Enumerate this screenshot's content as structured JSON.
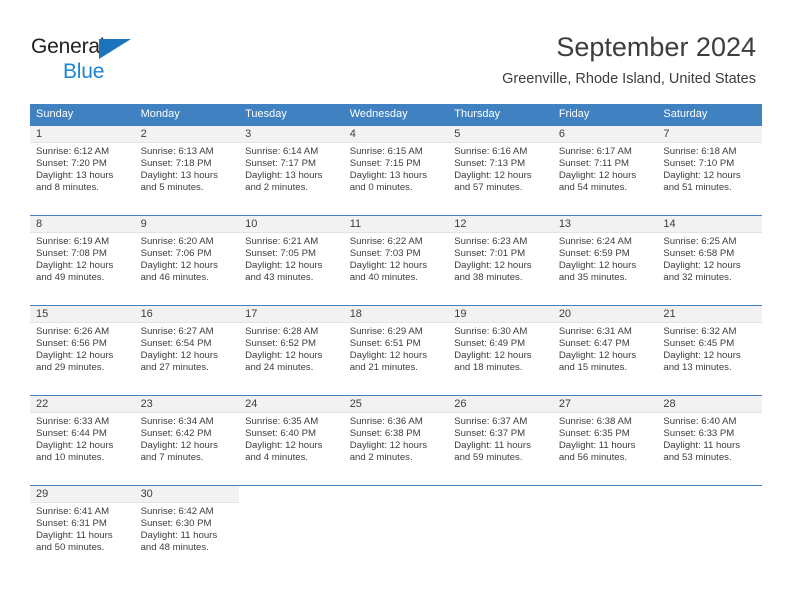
{
  "brand": {
    "name_top": "General",
    "name_bottom": "Blue",
    "accent_color": "#1c86d3",
    "triangle_color": "#1c75bc"
  },
  "header": {
    "title": "September 2024",
    "location": "Greenville, Rhode Island, United States"
  },
  "theme": {
    "header_row_bg": "#3f81c1",
    "header_row_text": "#ffffff",
    "daynum_strip_bg": "#f2f2f2",
    "text_color": "#3d3d3d",
    "cell_bg": "#ffffff"
  },
  "labels": {
    "sunrise_prefix": "Sunrise:",
    "sunset_prefix": "Sunset:",
    "daylight_prefix": "Daylight:"
  },
  "weekdays": [
    "Sunday",
    "Monday",
    "Tuesday",
    "Wednesday",
    "Thursday",
    "Friday",
    "Saturday"
  ],
  "weeks": [
    [
      {
        "day": "1",
        "sunrise": "Sunrise: 6:12 AM",
        "sunset": "Sunset: 7:20 PM",
        "daylight_line1": "Daylight: 13 hours",
        "daylight_line2": "and 8 minutes."
      },
      {
        "day": "2",
        "sunrise": "Sunrise: 6:13 AM",
        "sunset": "Sunset: 7:18 PM",
        "daylight_line1": "Daylight: 13 hours",
        "daylight_line2": "and 5 minutes."
      },
      {
        "day": "3",
        "sunrise": "Sunrise: 6:14 AM",
        "sunset": "Sunset: 7:17 PM",
        "daylight_line1": "Daylight: 13 hours",
        "daylight_line2": "and 2 minutes."
      },
      {
        "day": "4",
        "sunrise": "Sunrise: 6:15 AM",
        "sunset": "Sunset: 7:15 PM",
        "daylight_line1": "Daylight: 13 hours",
        "daylight_line2": "and 0 minutes."
      },
      {
        "day": "5",
        "sunrise": "Sunrise: 6:16 AM",
        "sunset": "Sunset: 7:13 PM",
        "daylight_line1": "Daylight: 12 hours",
        "daylight_line2": "and 57 minutes."
      },
      {
        "day": "6",
        "sunrise": "Sunrise: 6:17 AM",
        "sunset": "Sunset: 7:11 PM",
        "daylight_line1": "Daylight: 12 hours",
        "daylight_line2": "and 54 minutes."
      },
      {
        "day": "7",
        "sunrise": "Sunrise: 6:18 AM",
        "sunset": "Sunset: 7:10 PM",
        "daylight_line1": "Daylight: 12 hours",
        "daylight_line2": "and 51 minutes."
      }
    ],
    [
      {
        "day": "8",
        "sunrise": "Sunrise: 6:19 AM",
        "sunset": "Sunset: 7:08 PM",
        "daylight_line1": "Daylight: 12 hours",
        "daylight_line2": "and 49 minutes."
      },
      {
        "day": "9",
        "sunrise": "Sunrise: 6:20 AM",
        "sunset": "Sunset: 7:06 PM",
        "daylight_line1": "Daylight: 12 hours",
        "daylight_line2": "and 46 minutes."
      },
      {
        "day": "10",
        "sunrise": "Sunrise: 6:21 AM",
        "sunset": "Sunset: 7:05 PM",
        "daylight_line1": "Daylight: 12 hours",
        "daylight_line2": "and 43 minutes."
      },
      {
        "day": "11",
        "sunrise": "Sunrise: 6:22 AM",
        "sunset": "Sunset: 7:03 PM",
        "daylight_line1": "Daylight: 12 hours",
        "daylight_line2": "and 40 minutes."
      },
      {
        "day": "12",
        "sunrise": "Sunrise: 6:23 AM",
        "sunset": "Sunset: 7:01 PM",
        "daylight_line1": "Daylight: 12 hours",
        "daylight_line2": "and 38 minutes."
      },
      {
        "day": "13",
        "sunrise": "Sunrise: 6:24 AM",
        "sunset": "Sunset: 6:59 PM",
        "daylight_line1": "Daylight: 12 hours",
        "daylight_line2": "and 35 minutes."
      },
      {
        "day": "14",
        "sunrise": "Sunrise: 6:25 AM",
        "sunset": "Sunset: 6:58 PM",
        "daylight_line1": "Daylight: 12 hours",
        "daylight_line2": "and 32 minutes."
      }
    ],
    [
      {
        "day": "15",
        "sunrise": "Sunrise: 6:26 AM",
        "sunset": "Sunset: 6:56 PM",
        "daylight_line1": "Daylight: 12 hours",
        "daylight_line2": "and 29 minutes."
      },
      {
        "day": "16",
        "sunrise": "Sunrise: 6:27 AM",
        "sunset": "Sunset: 6:54 PM",
        "daylight_line1": "Daylight: 12 hours",
        "daylight_line2": "and 27 minutes."
      },
      {
        "day": "17",
        "sunrise": "Sunrise: 6:28 AM",
        "sunset": "Sunset: 6:52 PM",
        "daylight_line1": "Daylight: 12 hours",
        "daylight_line2": "and 24 minutes."
      },
      {
        "day": "18",
        "sunrise": "Sunrise: 6:29 AM",
        "sunset": "Sunset: 6:51 PM",
        "daylight_line1": "Daylight: 12 hours",
        "daylight_line2": "and 21 minutes."
      },
      {
        "day": "19",
        "sunrise": "Sunrise: 6:30 AM",
        "sunset": "Sunset: 6:49 PM",
        "daylight_line1": "Daylight: 12 hours",
        "daylight_line2": "and 18 minutes."
      },
      {
        "day": "20",
        "sunrise": "Sunrise: 6:31 AM",
        "sunset": "Sunset: 6:47 PM",
        "daylight_line1": "Daylight: 12 hours",
        "daylight_line2": "and 15 minutes."
      },
      {
        "day": "21",
        "sunrise": "Sunrise: 6:32 AM",
        "sunset": "Sunset: 6:45 PM",
        "daylight_line1": "Daylight: 12 hours",
        "daylight_line2": "and 13 minutes."
      }
    ],
    [
      {
        "day": "22",
        "sunrise": "Sunrise: 6:33 AM",
        "sunset": "Sunset: 6:44 PM",
        "daylight_line1": "Daylight: 12 hours",
        "daylight_line2": "and 10 minutes."
      },
      {
        "day": "23",
        "sunrise": "Sunrise: 6:34 AM",
        "sunset": "Sunset: 6:42 PM",
        "daylight_line1": "Daylight: 12 hours",
        "daylight_line2": "and 7 minutes."
      },
      {
        "day": "24",
        "sunrise": "Sunrise: 6:35 AM",
        "sunset": "Sunset: 6:40 PM",
        "daylight_line1": "Daylight: 12 hours",
        "daylight_line2": "and 4 minutes."
      },
      {
        "day": "25",
        "sunrise": "Sunrise: 6:36 AM",
        "sunset": "Sunset: 6:38 PM",
        "daylight_line1": "Daylight: 12 hours",
        "daylight_line2": "and 2 minutes."
      },
      {
        "day": "26",
        "sunrise": "Sunrise: 6:37 AM",
        "sunset": "Sunset: 6:37 PM",
        "daylight_line1": "Daylight: 11 hours",
        "daylight_line2": "and 59 minutes."
      },
      {
        "day": "27",
        "sunrise": "Sunrise: 6:38 AM",
        "sunset": "Sunset: 6:35 PM",
        "daylight_line1": "Daylight: 11 hours",
        "daylight_line2": "and 56 minutes."
      },
      {
        "day": "28",
        "sunrise": "Sunrise: 6:40 AM",
        "sunset": "Sunset: 6:33 PM",
        "daylight_line1": "Daylight: 11 hours",
        "daylight_line2": "and 53 minutes."
      }
    ],
    [
      {
        "day": "29",
        "sunrise": "Sunrise: 6:41 AM",
        "sunset": "Sunset: 6:31 PM",
        "daylight_line1": "Daylight: 11 hours",
        "daylight_line2": "and 50 minutes."
      },
      {
        "day": "30",
        "sunrise": "Sunrise: 6:42 AM",
        "sunset": "Sunset: 6:30 PM",
        "daylight_line1": "Daylight: 11 hours",
        "daylight_line2": "and 48 minutes."
      },
      {
        "day": "",
        "sunrise": "",
        "sunset": "",
        "daylight_line1": "",
        "daylight_line2": ""
      },
      {
        "day": "",
        "sunrise": "",
        "sunset": "",
        "daylight_line1": "",
        "daylight_line2": ""
      },
      {
        "day": "",
        "sunrise": "",
        "sunset": "",
        "daylight_line1": "",
        "daylight_line2": ""
      },
      {
        "day": "",
        "sunrise": "",
        "sunset": "",
        "daylight_line1": "",
        "daylight_line2": ""
      },
      {
        "day": "",
        "sunrise": "",
        "sunset": "",
        "daylight_line1": "",
        "daylight_line2": ""
      }
    ]
  ]
}
